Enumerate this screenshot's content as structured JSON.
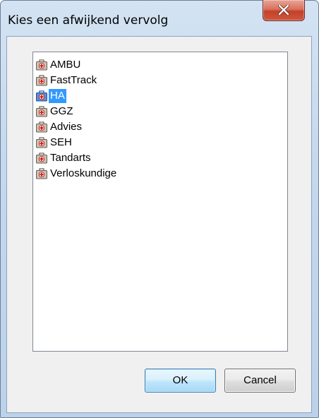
{
  "window": {
    "title": "Kies een afwijkend vervolg"
  },
  "list": {
    "items": [
      {
        "label": "AMBU",
        "icon": "medical-kit-icon",
        "selected": false
      },
      {
        "label": "FastTrack",
        "icon": "medical-kit-icon",
        "selected": false
      },
      {
        "label": "HA",
        "icon": "medical-kit-icon",
        "selected": true
      },
      {
        "label": "GGZ",
        "icon": "medical-kit-icon",
        "selected": false
      },
      {
        "label": "Advies",
        "icon": "medical-kit-icon",
        "selected": false
      },
      {
        "label": "SEH",
        "icon": "medical-kit-icon",
        "selected": false
      },
      {
        "label": "Tandarts",
        "icon": "medical-kit-icon",
        "selected": false
      },
      {
        "label": "Verloskundige",
        "icon": "medical-kit-icon",
        "selected": false
      }
    ]
  },
  "buttons": {
    "ok_label": "OK",
    "cancel_label": "Cancel"
  },
  "colors": {
    "selection": "#3399ff",
    "close_button": "#c2412c"
  }
}
